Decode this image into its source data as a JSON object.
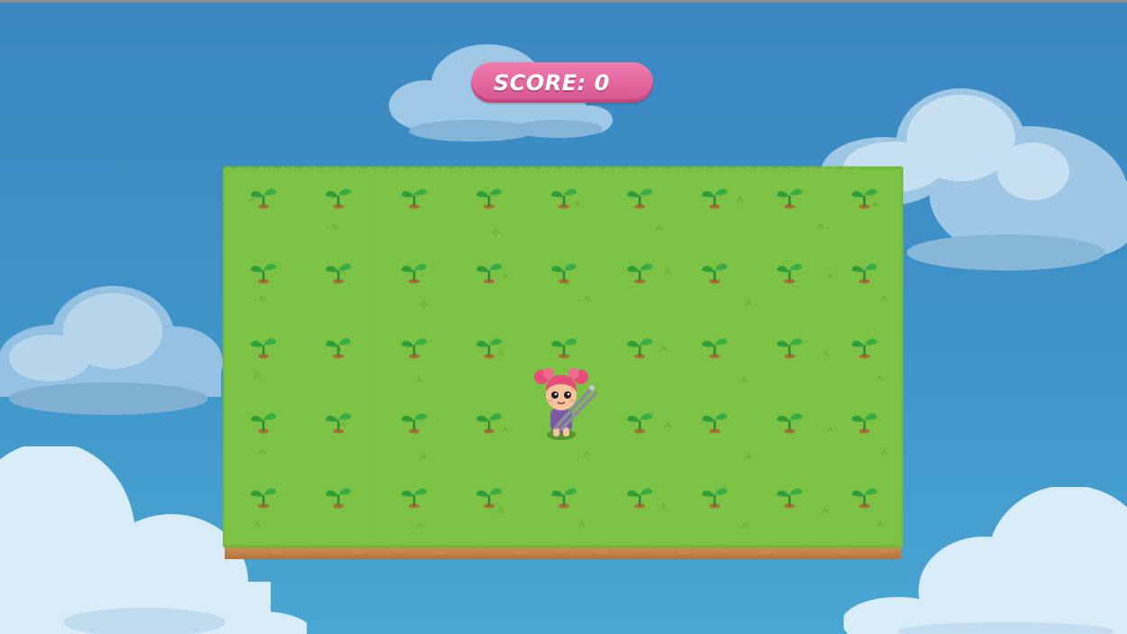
{
  "hud": {
    "score_label": "SCORE: 0",
    "score_value": 0
  },
  "colors": {
    "sky": "#3a86c1",
    "grass": "#7ac143",
    "dirt": "#c98a52",
    "score_pill": "#e0649b",
    "sprout": "#2e9e3a",
    "player_hair": "#e94b7a"
  },
  "field": {
    "rows": 5,
    "cols": 9,
    "sprout_icon": "sprout-icon",
    "player_icon": "girl-with-shears-icon",
    "player_cell": {
      "row": 3,
      "col": 5
    }
  }
}
